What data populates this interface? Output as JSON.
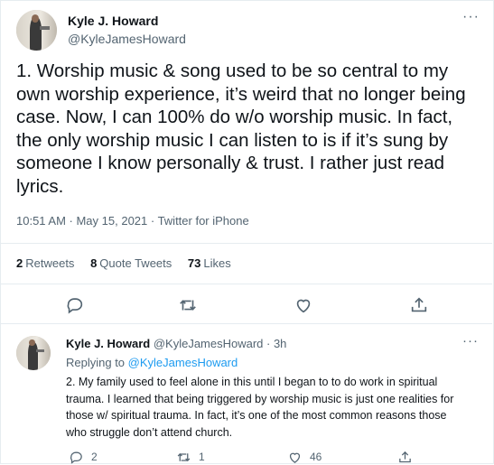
{
  "tweet": {
    "author_name": "Kyle J. Howard",
    "author_handle": "@KyleJamesHoward",
    "more_glyph": "···",
    "text": "1. Worship music & song used to be so central to my own worship experience, it’s weird that no longer being case. Now, I can 100% do w/o worship music. In fact, the only worship music I can listen to is if it’s sung by someone I know personally & trust. I rather just read lyrics.",
    "timestamp": "10:51 AM · May 15, 2021 · Twitter for iPhone",
    "stats": {
      "retweets_count": "2",
      "retweets_label": "Retweets",
      "quotes_count": "8",
      "quotes_label": "Quote Tweets",
      "likes_count": "73",
      "likes_label": "Likes"
    },
    "actions": [
      "reply-icon",
      "retweet-icon",
      "like-icon",
      "share-icon"
    ]
  },
  "reply": {
    "author_name": "Kyle J. Howard",
    "author_handle_time": "@KyleJamesHoward · 3h",
    "more_glyph": "···",
    "replying_prefix": "Replying to",
    "replying_to": "@KyleJamesHoward",
    "text": "2. My family used to feel alone in this until I began to to do work in spiritual trauma. I learned that being triggered by worship music is just one realities for those w/ spiritual trauma. In fact, it’s one of the most common reasons those who struggle don’t attend church.",
    "reply_count": "2",
    "retweet_count": "1",
    "like_count": "46"
  },
  "colors": {
    "text": "#0f1419",
    "muted": "#536471",
    "link": "#1d9bf0",
    "border": "#e6ecf0"
  }
}
